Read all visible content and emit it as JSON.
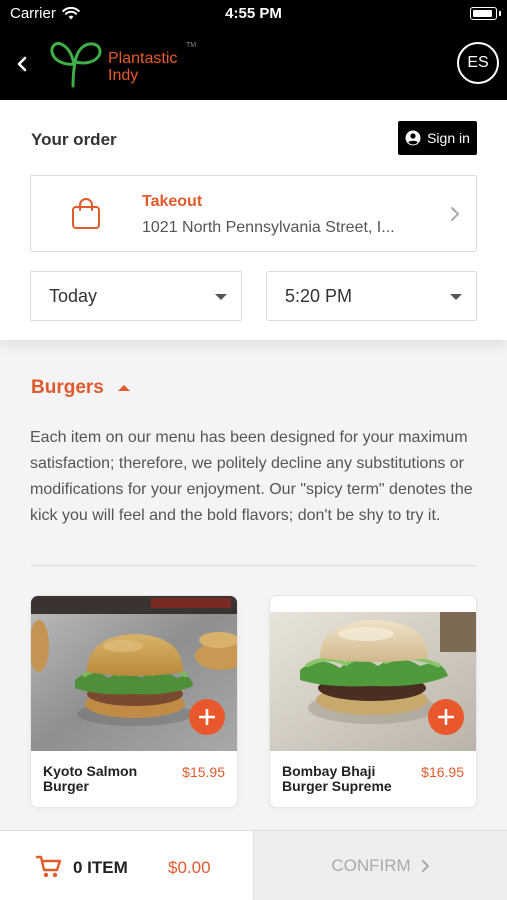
{
  "status_bar": {
    "carrier": "Carrier",
    "time": "4:55 PM",
    "icons": [
      "wifi-icon",
      "battery-icon"
    ]
  },
  "nav": {
    "back_icon": "chevron-left-icon",
    "brand_line1": "Plantastic",
    "brand_line2": "Indy",
    "tm": "TM",
    "avatar_initials": "ES"
  },
  "order": {
    "title": "Your order",
    "sign_in_label": "Sign in",
    "mode_label": "Takeout",
    "address": "1021 North Pennsylvania Street, I...",
    "day_value": "Today",
    "time_value": "5:20 PM"
  },
  "section": {
    "title": "Burgers",
    "description": "Each item on our menu has been designed for your maximum satisfaction; therefore, we politely decline any substitutions or modifications for your enjoyment. Our \"spicy term\" denotes the kick you will feel and the bold flavors; don't be shy to try it."
  },
  "menu_items": [
    {
      "name": "Kyoto Salmon Burger",
      "price": "$15.95"
    },
    {
      "name": "Bombay Bhaji Burger Supreme",
      "price": "$16.95"
    }
  ],
  "cart": {
    "count_label": "0 ITEM",
    "total": "$0.00",
    "confirm_label": "CONFIRM"
  },
  "colors": {
    "accent": "#e05a2b",
    "header_bg": "#000000",
    "logo_green": "#3fae49"
  }
}
